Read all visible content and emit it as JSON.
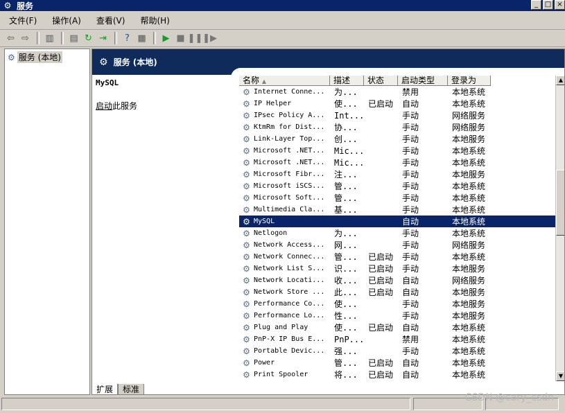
{
  "window": {
    "title": "服务",
    "buttons": [
      "_",
      "□",
      "×"
    ]
  },
  "menubar": [
    "文件(F)",
    "操作(A)",
    "查看(V)",
    "帮助(H)"
  ],
  "tree": {
    "root_label": "服务 (本地)"
  },
  "panel": {
    "header_title": "服务 (本地)",
    "selected_service": "MySQL",
    "action_link": "启动",
    "action_suffix": "此服务"
  },
  "columns": [
    "名称",
    "描述",
    "状态",
    "启动类型",
    "登录为"
  ],
  "services": [
    {
      "name": "Internet Conne...",
      "desc": "为...",
      "status": "",
      "startup": "禁用",
      "logon": "本地系统"
    },
    {
      "name": "IP Helper",
      "desc": "使...",
      "status": "已启动",
      "startup": "自动",
      "logon": "本地系统"
    },
    {
      "name": "IPsec Policy A...",
      "desc": "Int...",
      "status": "",
      "startup": "手动",
      "logon": "网络服务"
    },
    {
      "name": "KtmRm for Dist...",
      "desc": "协...",
      "status": "",
      "startup": "手动",
      "logon": "网络服务"
    },
    {
      "name": "Link-Layer Top...",
      "desc": "创...",
      "status": "",
      "startup": "手动",
      "logon": "本地服务"
    },
    {
      "name": "Microsoft .NET...",
      "desc": "Mic...",
      "status": "",
      "startup": "手动",
      "logon": "本地系统"
    },
    {
      "name": "Microsoft .NET...",
      "desc": "Mic...",
      "status": "",
      "startup": "手动",
      "logon": "本地系统"
    },
    {
      "name": "Microsoft Fibr...",
      "desc": "注...",
      "status": "",
      "startup": "手动",
      "logon": "本地服务"
    },
    {
      "name": "Microsoft iSCS...",
      "desc": "管...",
      "status": "",
      "startup": "手动",
      "logon": "本地系统"
    },
    {
      "name": "Microsoft Soft...",
      "desc": "管...",
      "status": "",
      "startup": "手动",
      "logon": "本地系统"
    },
    {
      "name": "Multimedia Cla...",
      "desc": "基...",
      "status": "",
      "startup": "手动",
      "logon": "本地系统"
    },
    {
      "name": "MySQL",
      "desc": "",
      "status": "",
      "startup": "自动",
      "logon": "本地系统",
      "selected": true
    },
    {
      "name": "Netlogon",
      "desc": "为...",
      "status": "",
      "startup": "手动",
      "logon": "本地系统"
    },
    {
      "name": "Network Access...",
      "desc": "网...",
      "status": "",
      "startup": "手动",
      "logon": "网络服务"
    },
    {
      "name": "Network Connec...",
      "desc": "管...",
      "status": "已启动",
      "startup": "手动",
      "logon": "本地系统"
    },
    {
      "name": "Network List S...",
      "desc": "识...",
      "status": "已启动",
      "startup": "手动",
      "logon": "本地服务"
    },
    {
      "name": "Network Locati...",
      "desc": "收...",
      "status": "已启动",
      "startup": "自动",
      "logon": "网络服务"
    },
    {
      "name": "Network Store ...",
      "desc": "此...",
      "status": "已启动",
      "startup": "自动",
      "logon": "本地服务"
    },
    {
      "name": "Performance Co...",
      "desc": "使...",
      "status": "",
      "startup": "手动",
      "logon": "本地服务"
    },
    {
      "name": "Performance Lo...",
      "desc": "性...",
      "status": "",
      "startup": "手动",
      "logon": "本地服务"
    },
    {
      "name": "Plug and Play",
      "desc": "使...",
      "status": "已启动",
      "startup": "自动",
      "logon": "本地系统"
    },
    {
      "name": "PnP-X IP Bus E...",
      "desc": "PnP...",
      "status": "",
      "startup": "禁用",
      "logon": "本地系统"
    },
    {
      "name": "Portable Devic...",
      "desc": "强...",
      "status": "",
      "startup": "手动",
      "logon": "本地系统"
    },
    {
      "name": "Power",
      "desc": "管...",
      "status": "已启动",
      "startup": "自动",
      "logon": "本地系统"
    },
    {
      "name": "Print Spooler",
      "desc": "将...",
      "status": "已启动",
      "startup": "自动",
      "logon": "本地系统"
    }
  ],
  "tabs": [
    "扩展",
    "标准"
  ],
  "watermark": "CSDN @cary_csdn"
}
